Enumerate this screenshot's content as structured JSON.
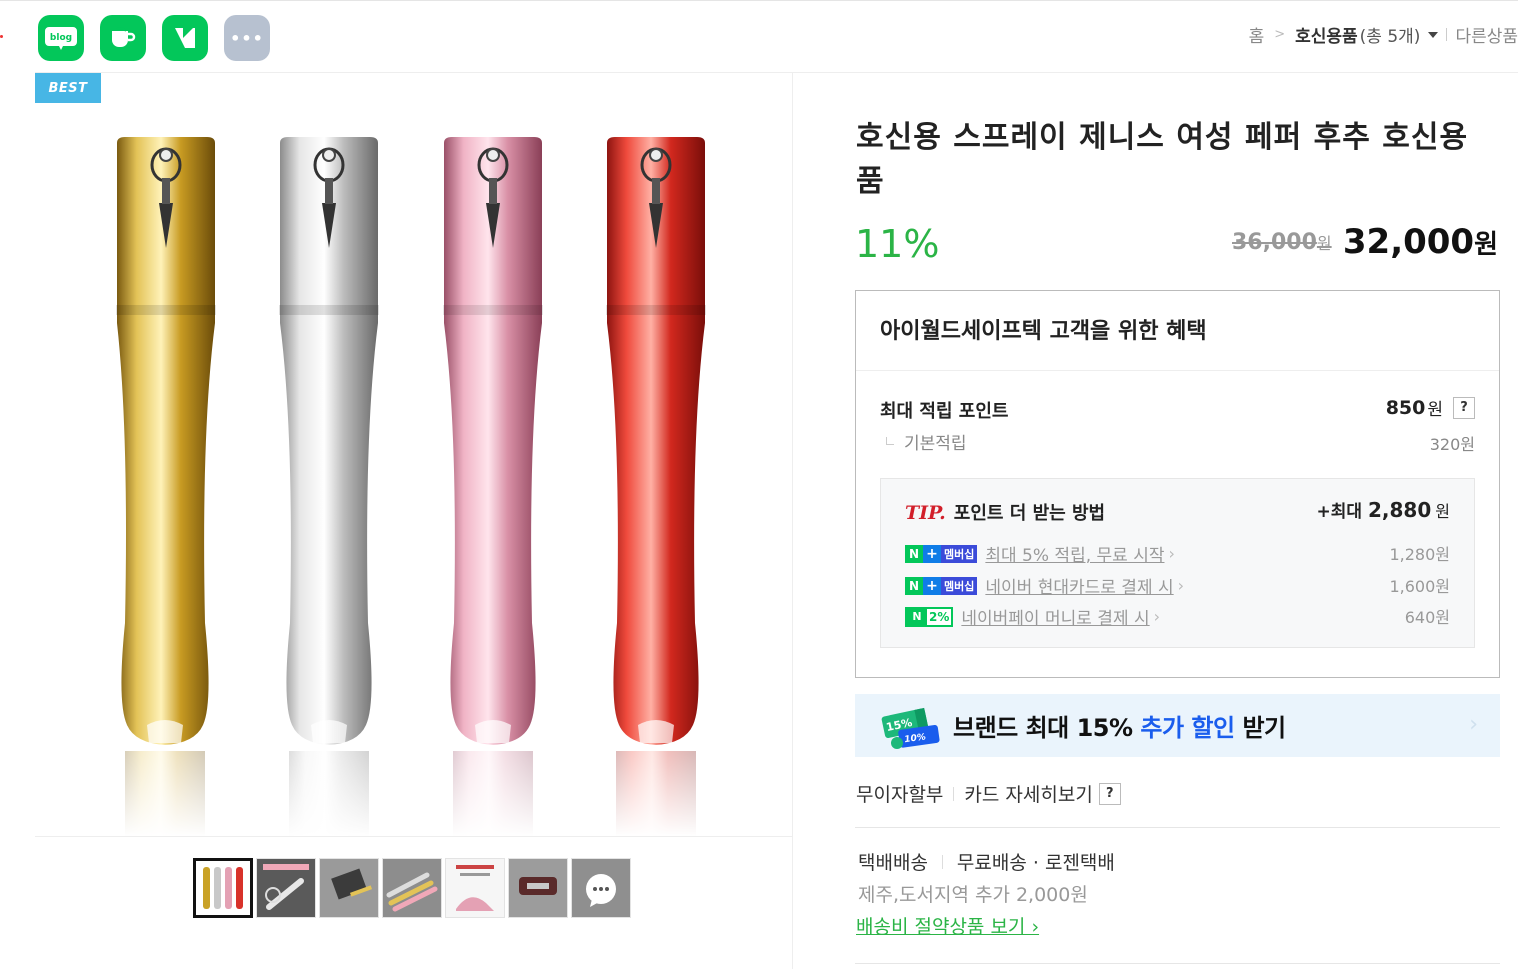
{
  "share": {
    "items": [
      {
        "name": "blog",
        "label": "blog"
      },
      {
        "name": "cafe",
        "label": ""
      },
      {
        "name": "band",
        "label": ""
      },
      {
        "name": "more",
        "label": "•••"
      }
    ]
  },
  "breadcrumb": {
    "home": "홈",
    "current": "호신용품",
    "count": "(총 5개)",
    "other": "다른상품"
  },
  "badge": "BEST",
  "product": {
    "title": "호신용 스프레이 제니스 여성 페퍼 후추 호신용품",
    "discount": "11%",
    "original_price": "36,000",
    "original_unit": "원",
    "price": "32,000",
    "price_unit": "원",
    "colors": [
      "#c9a227",
      "#c8c8c8",
      "#e4a1b4",
      "#d8322a"
    ]
  },
  "benefit": {
    "heading": "아이월드세이프텍 고객을 위한 혜택",
    "max_point_label": "최대 적립 포인트",
    "max_point_value": "850",
    "max_point_unit": "원",
    "help": "?",
    "basic_label": "기본적립",
    "basic_value": "320원",
    "tip": {
      "logo": "TIP.",
      "heading": "포인트 더 받는 방법",
      "max_prefix": "+최대",
      "max_value": "2,880",
      "max_unit": "원",
      "rows": [
        {
          "badge_n": "N",
          "badge_plus": "+",
          "badge_m": "멤버십",
          "text": "최대 5% 적립, 무료 시작",
          "value": "1,280원"
        },
        {
          "badge_n": "N",
          "badge_plus": "+",
          "badge_m": "멤버십",
          "text": "네이버 현대카드로 결제 시",
          "value": "1,600원"
        },
        {
          "badge_n": "N",
          "badge_pct": "2%",
          "text": "네이버페이 머니로 결제 시",
          "value": "640원"
        }
      ]
    }
  },
  "brand": {
    "coupon_a": "15%",
    "coupon_b": "10%",
    "text_pre": "브랜드 최대 15% ",
    "text_blue": "추가 할인",
    "text_post": " 받기"
  },
  "installment": {
    "label": "무이자할부",
    "card": "카드 자세히보기",
    "help": "?"
  },
  "shipping": {
    "method": "택배배송",
    "detail": "무료배송 · 로젠택배",
    "extra": "제주,도서지역 추가 2,000원",
    "saving_link": "배송비 절약상품 보기 ›"
  }
}
